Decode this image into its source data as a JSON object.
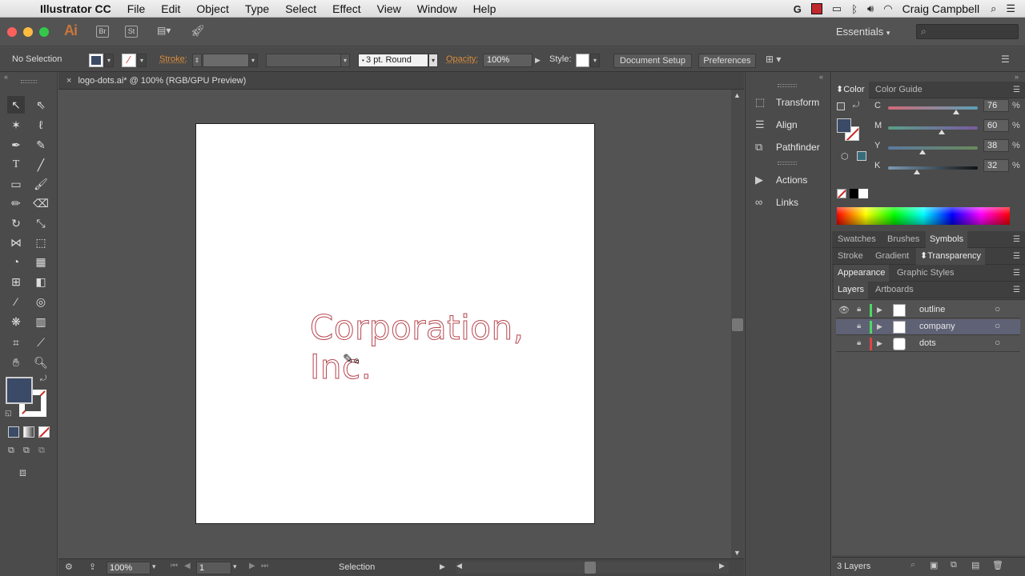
{
  "menubar": {
    "app_name": "Illustrator CC",
    "items": [
      "File",
      "Edit",
      "Object",
      "Type",
      "Select",
      "Effect",
      "View",
      "Window",
      "Help"
    ],
    "user": "Craig Campbell"
  },
  "appbar": {
    "logo": "Ai",
    "bridge": "Br",
    "stock": "St",
    "workspace": "Essentials"
  },
  "control": {
    "selection": "No Selection",
    "stroke_label": "Stroke:",
    "stroke_profile": "3 pt. Round",
    "opacity_label": "Opacity:",
    "opacity_value": "100%",
    "style_label": "Style:",
    "document_setup": "Document Setup",
    "preferences": "Preferences"
  },
  "document": {
    "tab_title": "logo-dots.ai* @ 100% (RGB/GPU Preview)",
    "artboard_text": "Corporation, Inc."
  },
  "status": {
    "zoom": "100%",
    "artboard_num": "1",
    "tool": "Selection"
  },
  "dock": {
    "items": [
      {
        "label": "Transform",
        "icon": "transform-icon"
      },
      {
        "label": "Align",
        "icon": "align-icon"
      },
      {
        "label": "Pathfinder",
        "icon": "pathfinder-icon"
      },
      {
        "label": "Actions",
        "icon": "actions-icon"
      },
      {
        "label": "Links",
        "icon": "links-icon"
      }
    ]
  },
  "color_panel": {
    "tabs": [
      "Color",
      "Color Guide"
    ],
    "channels": [
      {
        "label": "C",
        "value": "76",
        "fraction": 0.76
      },
      {
        "label": "M",
        "value": "60",
        "fraction": 0.6
      },
      {
        "label": "Y",
        "value": "38",
        "fraction": 0.38
      },
      {
        "label": "K",
        "value": "32",
        "fraction": 0.32
      }
    ],
    "fill_color": "#3b4a66",
    "pct": "%"
  },
  "panels": {
    "row1": [
      "Swatches",
      "Brushes",
      "Symbols"
    ],
    "row2": [
      "Stroke",
      "Gradient",
      "Transparency"
    ],
    "row3": [
      "Appearance",
      "Graphic Styles"
    ],
    "row4": [
      "Layers",
      "Artboards"
    ]
  },
  "layers": {
    "rows": [
      {
        "name": "outline",
        "color": "#4cd964"
      },
      {
        "name": "company",
        "color": "#4cd964"
      },
      {
        "name": "dots",
        "color": "#e04444"
      }
    ],
    "count": "3 Layers"
  },
  "colors": {
    "accent_orange": "#d98c3c",
    "logo_stroke": "#b7464f"
  }
}
